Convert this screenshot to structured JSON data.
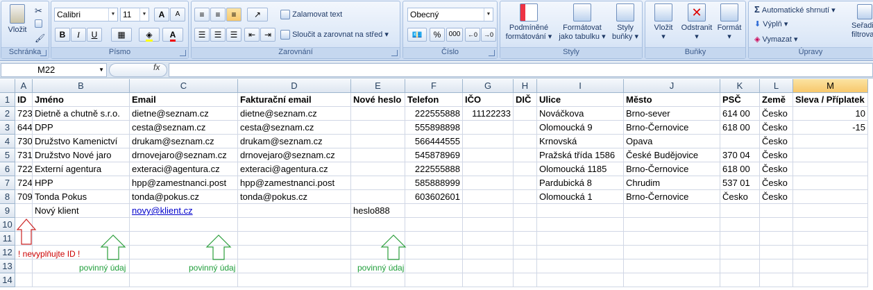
{
  "ribbon": {
    "clipboard": {
      "group_label": "Schránka",
      "paste_label": "Vložit"
    },
    "font": {
      "group_label": "Písmo",
      "font_name": "Calibri",
      "font_size": "11",
      "bold": "B",
      "italic": "I",
      "underline": "U",
      "grow": "A",
      "shrink": "A",
      "color_letter": "A"
    },
    "alignment": {
      "group_label": "Zarovnání",
      "wrap_label": "Zalamovat text",
      "merge_label": "Sloučit a zarovnat na střed"
    },
    "number": {
      "group_label": "Číslo",
      "format": "Obecný",
      "percent": "%",
      "thousands": "000"
    },
    "styles": {
      "group_label": "Styly",
      "cond_label_1": "Podmíněné",
      "cond_label_2": "formátování",
      "table_label_1": "Formátovat",
      "table_label_2": "jako tabulku",
      "cell_label_1": "Styly",
      "cell_label_2": "buňky"
    },
    "cells": {
      "group_label": "Buňky",
      "insert_label": "Vložit",
      "delete_label": "Odstranit",
      "format_label": "Formát"
    },
    "editing": {
      "group_label": "Úpravy",
      "autosum_label": "Automatické shrnutí",
      "fill_label": "Výplň",
      "clear_label": "Vymazat",
      "sort_label_1": "Seřadi",
      "sort_label_2": "filtrova"
    }
  },
  "formula_bar": {
    "name_box": "M22",
    "fx": "fx",
    "formula": ""
  },
  "columns": [
    {
      "letter": "A",
      "w": 25
    },
    {
      "letter": "B",
      "w": 140
    },
    {
      "letter": "C",
      "w": 156
    },
    {
      "letter": "D",
      "w": 163
    },
    {
      "letter": "E",
      "w": 78
    },
    {
      "letter": "F",
      "w": 83
    },
    {
      "letter": "G",
      "w": 73
    },
    {
      "letter": "H",
      "w": 34
    },
    {
      "letter": "I",
      "w": 125
    },
    {
      "letter": "J",
      "w": 139
    },
    {
      "letter": "K",
      "w": 57
    },
    {
      "letter": "L",
      "w": 48
    },
    {
      "letter": "M",
      "w": 108
    }
  ],
  "rows": [
    {
      "n": "1",
      "cells": [
        "ID",
        "Jméno",
        "Email",
        "Fakturační email",
        "Nové heslo",
        "Telefon",
        "IČO",
        "DIČ",
        "Ulice",
        "Město",
        "PSČ",
        "Země",
        "Sleva / Příplatek"
      ]
    },
    {
      "n": "2",
      "cells": [
        "723",
        "Dietně a chutně s.r.o.",
        "dietne@seznam.cz",
        "dietne@seznam.cz",
        "",
        "222555888",
        "11122233",
        "",
        "Nováčkova",
        "Brno-sever",
        "614 00",
        "Česko",
        "10"
      ]
    },
    {
      "n": "3",
      "cells": [
        "644",
        "DPP",
        "cesta@seznam.cz",
        "cesta@seznam.cz",
        "",
        "555898898",
        "",
        "",
        "Olomoucká 9",
        "Brno-Černovice",
        "618 00",
        "Česko",
        "-15"
      ]
    },
    {
      "n": "4",
      "cells": [
        "730",
        "Družstvo Kamenictví",
        "drukam@seznam.cz",
        "drukam@seznam.cz",
        "",
        "566444555",
        "",
        "",
        "Krnovská",
        "Opava",
        "",
        "Česko",
        ""
      ]
    },
    {
      "n": "5",
      "cells": [
        "731",
        "Družstvo Nové jaro",
        "drnovejaro@seznam.cz",
        "drnovejaro@seznam.cz",
        "",
        "545878969",
        "",
        "",
        "Pražská třída 1586",
        "České Budějovice",
        "370 04",
        "Česko",
        ""
      ]
    },
    {
      "n": "6",
      "cells": [
        "722",
        "Externí agentura",
        "exteraci@agentura.cz",
        "exteraci@agentura.cz",
        "",
        "222555888",
        "",
        "",
        "Olomoucká 1185",
        "Brno-Černovice",
        "618 00",
        "Česko",
        ""
      ]
    },
    {
      "n": "7",
      "cells": [
        "724",
        "HPP",
        "hpp@zamestnanci.post",
        "hpp@zamestnanci.post",
        "",
        "585888999",
        "",
        "",
        "Pardubická 8",
        "Chrudim",
        "537 01",
        "Česko",
        ""
      ]
    },
    {
      "n": "8",
      "cells": [
        "709",
        "Tonda Pokus",
        "tonda@pokus.cz",
        "tonda@pokus.cz",
        "",
        "603602601",
        "",
        "",
        "Olomoucká 1",
        "Brno-Černovice",
        "Česko",
        "Česko",
        ""
      ]
    },
    {
      "n": "9",
      "cells": [
        "",
        "Nový klient",
        "novy@klient.cz",
        "",
        "heslo888",
        "",
        "",
        "",
        "",
        "",
        "",
        "",
        ""
      ]
    },
    {
      "n": "10",
      "cells": [
        "",
        "",
        "",
        "",
        "",
        "",
        "",
        "",
        "",
        "",
        "",
        "",
        ""
      ]
    },
    {
      "n": "11",
      "cells": [
        "",
        "",
        "",
        "",
        "",
        "",
        "",
        "",
        "",
        "",
        "",
        "",
        ""
      ]
    },
    {
      "n": "12",
      "cells": [
        "",
        "",
        "",
        "",
        "",
        "",
        "",
        "",
        "",
        "",
        "",
        "",
        ""
      ]
    },
    {
      "n": "13",
      "cells": [
        "",
        "",
        "",
        "",
        "",
        "",
        "",
        "",
        "",
        "",
        "",
        "",
        ""
      ]
    },
    {
      "n": "14",
      "cells": [
        "",
        "",
        "",
        "",
        "",
        "",
        "",
        "",
        "",
        "",
        "",
        "",
        ""
      ]
    }
  ],
  "annotations": {
    "id_warning": "! nevyplňujte ID !",
    "required_1": "povinný údaj",
    "required_2": "povinný údaj",
    "required_3": "povinný údaj"
  },
  "colors": {
    "warning": "#cc0000",
    "required": "#1f9e3a",
    "selected_header": "#f7c86c"
  }
}
